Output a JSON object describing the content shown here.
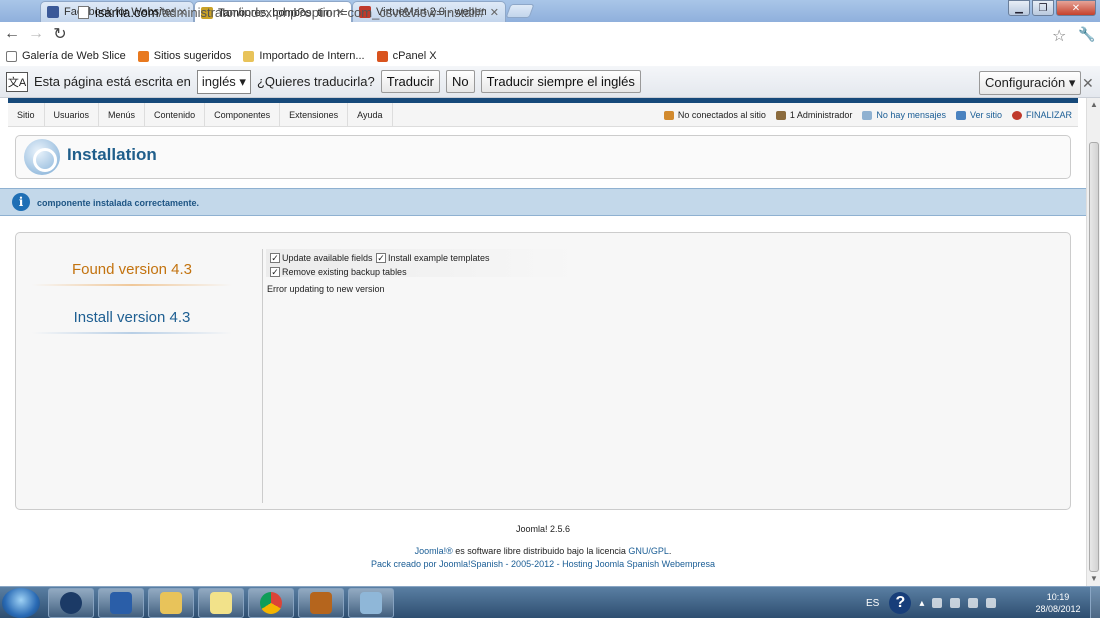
{
  "browser": {
    "tabs": [
      {
        "label": "Facebook for Websites - De",
        "favicon_color": "#3b5998"
      },
      {
        "label": "Tambores, bombos, timba",
        "favicon_color": "#c9a227"
      },
      {
        "label": "VirtueMart 2.0 - webempre",
        "favicon_color": "#c0392b"
      }
    ],
    "url": {
      "host": "isarria.com",
      "path": "/administrator/index.php?option=com_csvi&view=install#"
    },
    "bookmarks": [
      {
        "label": "Galería de Web Slice",
        "color": "#777777"
      },
      {
        "label": "Sitios sugeridos",
        "color": "#e8791f"
      },
      {
        "label": "Importado de Intern...",
        "color": "#e8c35a"
      },
      {
        "label": "cPanel X",
        "color": "#d9531e"
      }
    ],
    "translate": {
      "prompt": "Esta página está escrita en",
      "language": "inglés",
      "question": "¿Quieres traducirla?",
      "translate_btn": "Traducir",
      "no_btn": "No",
      "always_btn": "Traducir siempre el inglés",
      "config_btn": "Configuración"
    }
  },
  "admin_menu": {
    "items": [
      "Sitio",
      "Usuarios",
      "Menús",
      "Contenido",
      "Componentes",
      "Extensiones",
      "Ayuda"
    ],
    "status": {
      "not_connected": "No conectados al sitio",
      "admins": "1 Administrador",
      "messages": "No hay mensajes",
      "view_site": "Ver sitio",
      "logout": "FINALIZAR"
    }
  },
  "page": {
    "title": "Installation",
    "message": "componente instalada correctamente.",
    "found_version": "Found version 4.3",
    "install_version": "Install version 4.3",
    "options": {
      "update_fields": "Update available fields",
      "install_templates": "Install example templates",
      "remove_backup": "Remove existing backup tables"
    },
    "error": "Error updating to new version"
  },
  "footer": {
    "version": "Joomla! 2.5.6",
    "license_link": "Joomla!®",
    "license_text": " es software libre distribuido bajo la licencia ",
    "license_name": "GNU/GPL",
    "license_end": ".",
    "pack": "Pack creado por Joomla!Spanish - 2005-2012 - Hosting Joomla Spanish Webempresa"
  },
  "taskbar": {
    "language": "ES",
    "time": "10:19",
    "date": "28/08/2012"
  }
}
